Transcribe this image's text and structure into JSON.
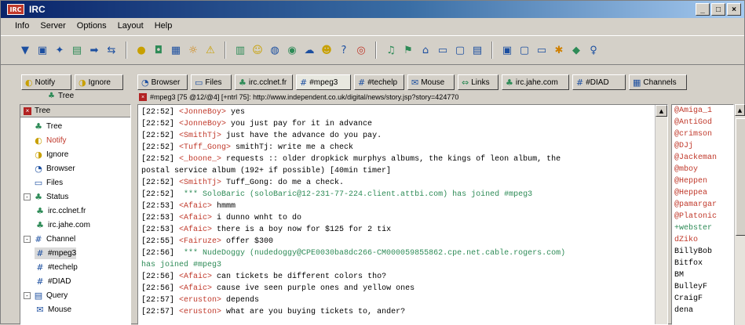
{
  "window": {
    "title": "IRC",
    "app_icon": "IRC",
    "controls": [
      "_",
      "□",
      "×"
    ]
  },
  "menu": [
    "Info",
    "Server",
    "Options",
    "Layout",
    "Help"
  ],
  "toolbar": {
    "groups": [
      [
        "marker-icon",
        "tool-icon",
        "star-icon",
        "folder-icon",
        "arrow-icon",
        "link-icon"
      ],
      [
        "ball-icon",
        "disc-icon",
        "grid-icon",
        "sun-icon",
        "warning-icon"
      ],
      [
        "chart-icon",
        "face-icon",
        "globe-icon",
        "plug-icon",
        "cloud-icon",
        "face2-icon",
        "help-icon",
        "target-icon"
      ],
      [
        "speaker-icon",
        "bell-icon",
        "home-icon",
        "document-icon",
        "window-icon",
        "notes-icon"
      ],
      [
        "panel-icon",
        "screen-icon",
        "monitor-icon",
        "gear-icon",
        "badge-icon",
        "bulb-icon"
      ]
    ]
  },
  "tabs": [
    {
      "label": "Notify",
      "icon": "notify-icon"
    },
    {
      "label": "Ignore",
      "icon": "ignore-icon"
    },
    {
      "label": "Browser",
      "icon": "browser-icon"
    },
    {
      "label": "Files",
      "icon": "files-icon"
    },
    {
      "label": "irc.cclnet.fr",
      "icon": "server-icon"
    },
    {
      "label": "#mpeg3",
      "icon": "channel-icon",
      "active": true
    },
    {
      "label": "#techelp",
      "icon": "channel-icon"
    },
    {
      "label": "Mouse",
      "icon": "mouse-icon"
    },
    {
      "label": "Links",
      "icon": "links-icon"
    },
    {
      "label": "irc.jahe.com",
      "icon": "server-icon"
    },
    {
      "label": "#DIAD",
      "icon": "channel-icon"
    },
    {
      "label": "Channels",
      "icon": "channels-icon"
    }
  ],
  "tree": {
    "header": "Tree",
    "title": "Tree",
    "items": [
      {
        "label": "Tree",
        "icon": "tree-icon",
        "level": 1
      },
      {
        "label": "Notify",
        "icon": "notify-icon",
        "level": 1,
        "red": true
      },
      {
        "label": "Ignore",
        "icon": "ignore-icon",
        "level": 1
      },
      {
        "label": "Browser",
        "icon": "browser-icon",
        "level": 1
      },
      {
        "label": "Files",
        "icon": "files-icon",
        "level": 1
      },
      {
        "label": "Status",
        "icon": "status-icon",
        "level": 1,
        "expander": "-"
      },
      {
        "label": "irc.cclnet.fr",
        "icon": "server-icon",
        "level": 2
      },
      {
        "label": "irc.jahe.com",
        "icon": "server-icon",
        "level": 2
      },
      {
        "label": "Channel",
        "icon": "channel-icon",
        "level": 1,
        "expander": "-"
      },
      {
        "label": "#mpeg3",
        "icon": "channel-icon",
        "level": 2,
        "selected": true
      },
      {
        "label": "#techelp",
        "icon": "channel-icon",
        "level": 2
      },
      {
        "label": "#DIAD",
        "icon": "channel-icon",
        "level": 2
      },
      {
        "label": "Query",
        "icon": "query-icon",
        "level": 1,
        "expander": "-"
      },
      {
        "label": "Mouse",
        "icon": "mouse-icon",
        "level": 2
      }
    ]
  },
  "address": "#mpeg3 [75 @12/@4] [+ntrl 75]: http://www.independent.co.uk/digital/news/story.jsp?story=424770",
  "chat": [
    {
      "ts": "[22:52]",
      "nick": "<JonneBoy>",
      "msg": " yes"
    },
    {
      "ts": "[22:52]",
      "nick": "<JonneBoy>",
      "msg": " you just pay for it in advance"
    },
    {
      "ts": "[22:52]",
      "nick": "<SmithTj>",
      "msg": " just have the advance do you pay."
    },
    {
      "ts": "[22:52]",
      "nick": "<Tuff_Gong>",
      "msg": " smithTj: write me a check"
    },
    {
      "ts": "[22:52]",
      "nick": "<_boone_>",
      "msg": " requests :: older dropkick murphys albums, the kings of leon album, the"
    },
    {
      "ts": "",
      "nick": "",
      "msg": "postal service album (192+ if possible) [40min timer]"
    },
    {
      "ts": "[22:52]",
      "nick": "<SmithTj>",
      "msg": " Tuff_Gong: do me a check."
    },
    {
      "ts": "[22:52]",
      "nick": "",
      "msg": " *** SoloBaric (soloBaric@12-231-77-224.client.attbi.com) has joined #mpeg3",
      "join": true
    },
    {
      "ts": "[22:53]",
      "nick": "<Afaic>",
      "msg": " hmmm"
    },
    {
      "ts": "[22:53]",
      "nick": "<Afaic>",
      "msg": " i dunno wnht to do"
    },
    {
      "ts": "[22:53]",
      "nick": "<Afaic>",
      "msg": " there is a boy now for $125 for 2 tix"
    },
    {
      "ts": "[22:55]",
      "nick": "<Fairuze>",
      "msg": " offer $300"
    },
    {
      "ts": "[22:56]",
      "nick": "",
      "msg": " *** NudeDoggy (nudedoggy@CPE0030ba8dc266-CM000059855862.cpe.net.cable.rogers.com)",
      "join": true
    },
    {
      "ts": "",
      "nick": "",
      "msg": "has joined #mpeg3",
      "join": true
    },
    {
      "ts": "[22:56]",
      "nick": "<Afaic>",
      "msg": " can tickets be different colors tho?"
    },
    {
      "ts": "[22:56]",
      "nick": "<Afaic>",
      "msg": " cause ive seen purple ones and yellow ones"
    },
    {
      "ts": "[22:57]",
      "nick": "<eruston>",
      "msg": " depends"
    },
    {
      "ts": "[22:57]",
      "nick": "<eruston>",
      "msg": " what are you buying tickets to, ander?"
    }
  ],
  "nicklist": [
    {
      "nick": "@Amiga_1",
      "type": "op"
    },
    {
      "nick": "@AntiGod",
      "type": "op"
    },
    {
      "nick": "@crimson",
      "type": "op"
    },
    {
      "nick": "@DJj",
      "type": "op"
    },
    {
      "nick": "@Jackeman",
      "type": "op"
    },
    {
      "nick": "@mboy",
      "type": "op"
    },
    {
      "nick": "@Heppen",
      "type": "op"
    },
    {
      "nick": "@Heppea",
      "type": "op"
    },
    {
      "nick": "@pamargar",
      "type": "op"
    },
    {
      "nick": "@Platonic",
      "type": "op"
    },
    {
      "nick": "+webster",
      "type": "voice"
    },
    {
      "nick": "dZiko",
      "type": "op"
    },
    {
      "nick": "BillyBob",
      "type": "normal"
    },
    {
      "nick": "Bitfox",
      "type": "normal"
    },
    {
      "nick": "BM",
      "type": "normal"
    },
    {
      "nick": "BulleyF",
      "type": "normal"
    },
    {
      "nick": "CraigF",
      "type": "normal"
    },
    {
      "nick": "dena",
      "type": "normal"
    }
  ],
  "colors": {
    "titlebar_start": "#0a246a",
    "nick_op": "#c0392b",
    "join": "#2e8b57",
    "face": "#d4d0c8"
  }
}
